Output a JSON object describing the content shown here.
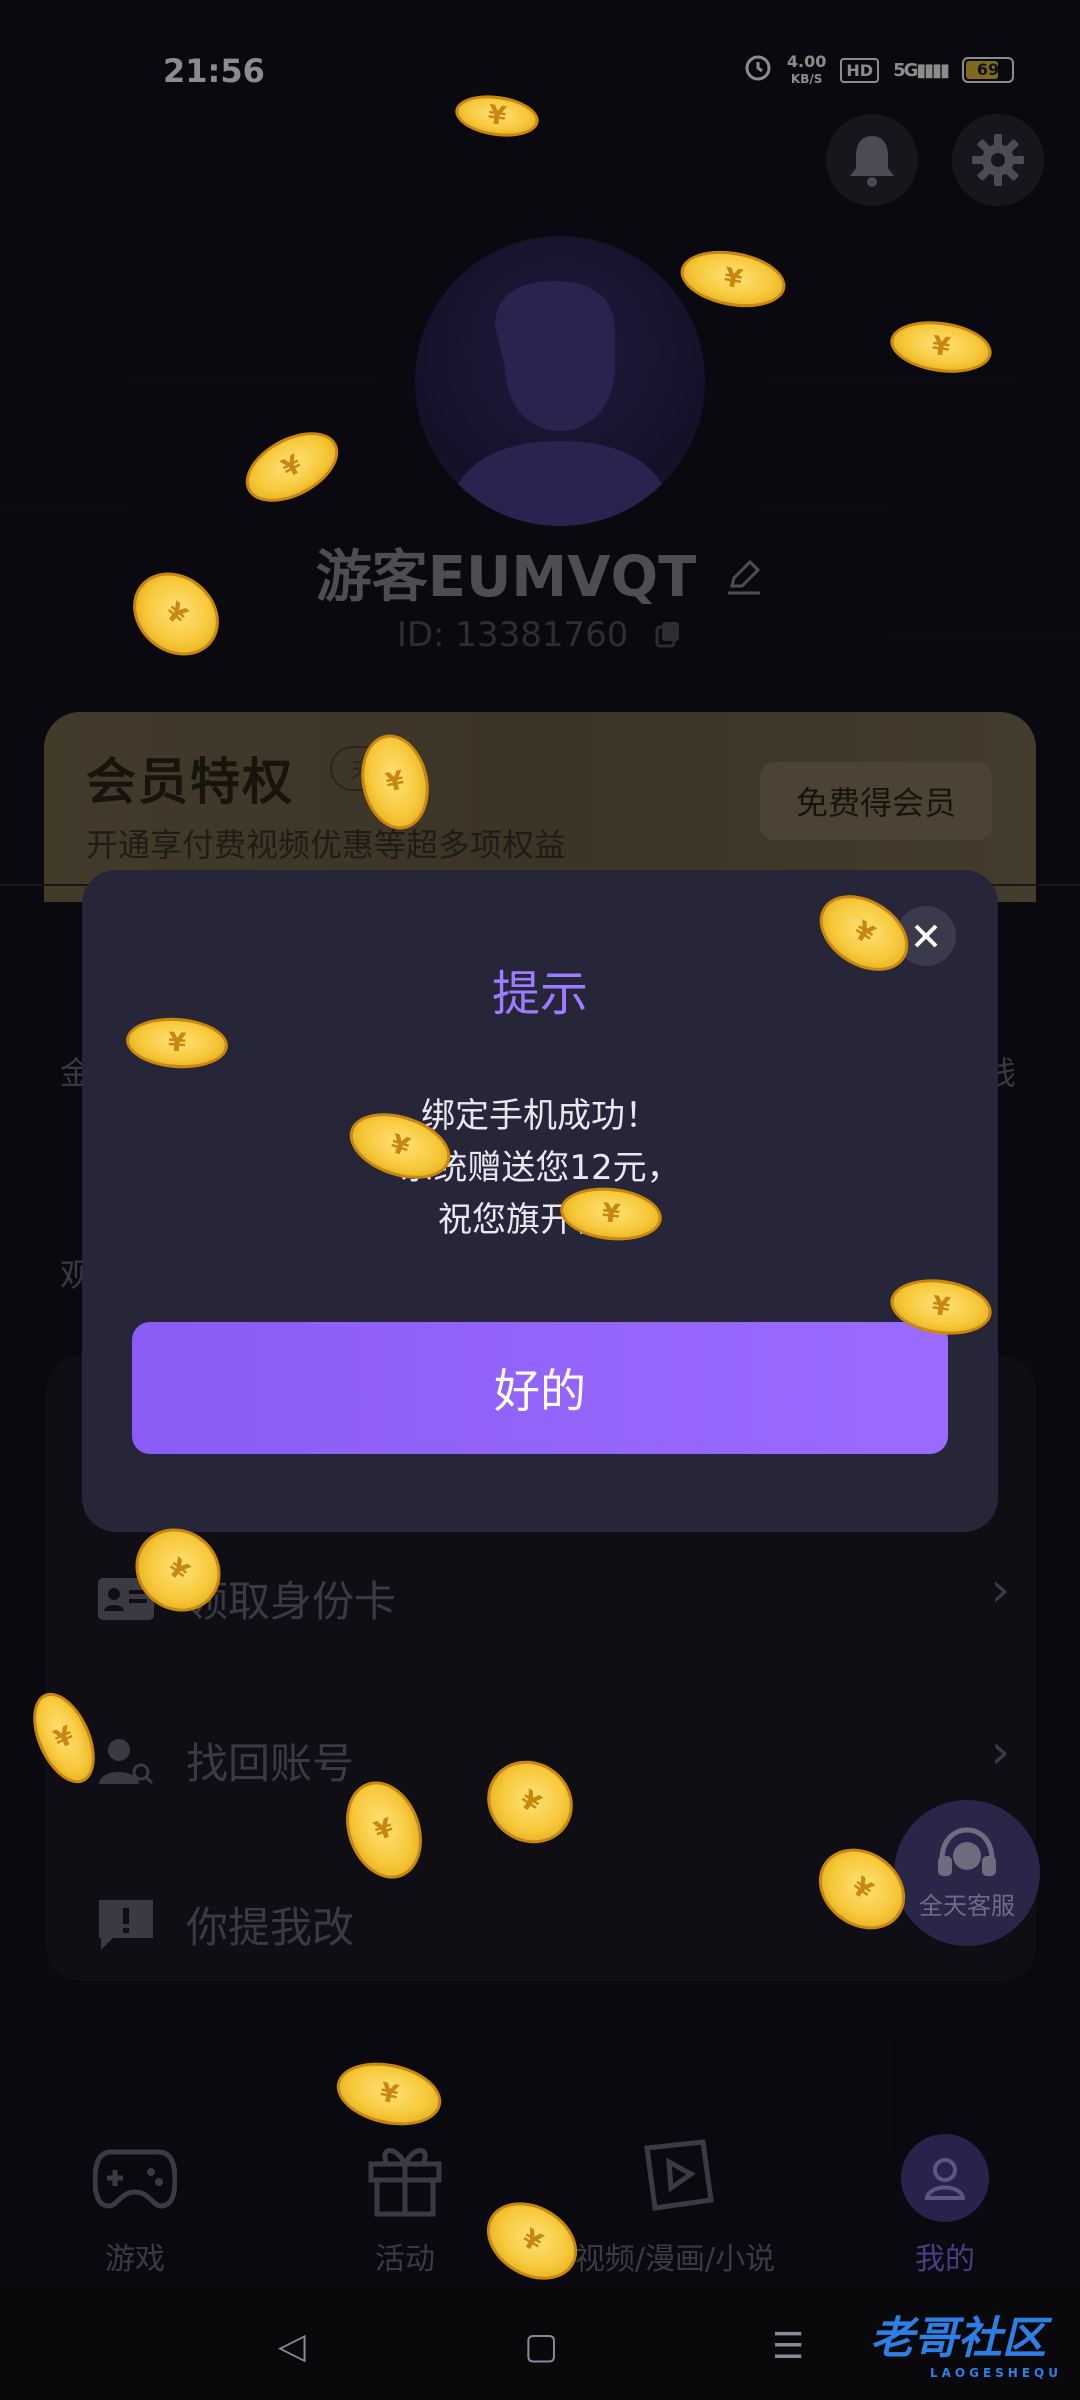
{
  "status_bar": {
    "time": "21:56",
    "net_speed": "4.00",
    "net_unit": "KB/S",
    "hd": "HD",
    "signal": "5G",
    "battery": "69"
  },
  "profile": {
    "username": "游客EUMVQT",
    "user_id": "ID: 13381760"
  },
  "vip": {
    "title": "会员特权",
    "tag": "未",
    "subtitle": "开通享付费视频优惠等超多项权益",
    "button": "免费得会员"
  },
  "partial": {
    "left_1": "金",
    "left_2": "观",
    "right_1": "钱"
  },
  "menu": {
    "items": [
      {
        "label": "领取身份卡"
      },
      {
        "label": "找回账号"
      },
      {
        "label": "你提我改"
      }
    ]
  },
  "support_float": {
    "label": "全天客服"
  },
  "bottom_nav": [
    {
      "label": "游戏"
    },
    {
      "label": "活动"
    },
    {
      "label": "视频/漫画/小说"
    },
    {
      "label": "我的"
    }
  ],
  "dialog": {
    "title": "提示",
    "line1": "绑定手机成功！",
    "line2": "系统赠送您12元，",
    "line3": "祝您旗开得胜",
    "ok_button": "好的"
  },
  "watermark": {
    "text": "老哥社区",
    "sub": "LAOGESHEQU"
  },
  "coin_symbol": "¥",
  "colors": {
    "accent": "#9b6bff",
    "background": "#13121c",
    "dialog_bg": "#272639",
    "vip_gold": "#7a6a4e"
  }
}
